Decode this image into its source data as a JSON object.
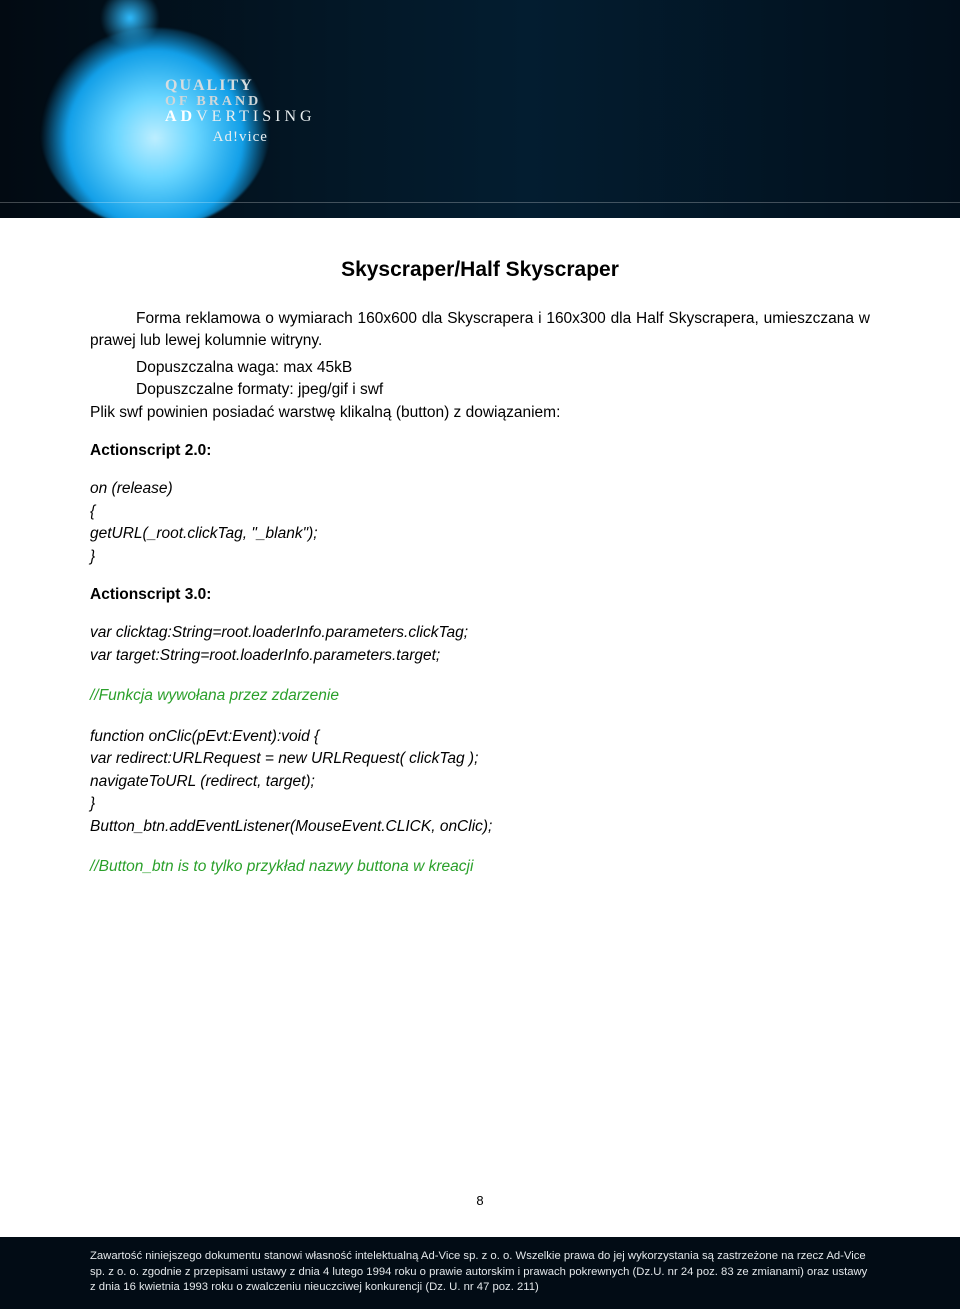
{
  "banner": {
    "line1": "QUALITY",
    "line2": "OF BRAND",
    "line3_bold": "AD",
    "line3_rest": "VERTISING",
    "line4": "Ad!vice"
  },
  "title": "Skyscraper/Half Skyscraper",
  "intro": "Forma reklamowa o wymiarach 160x600 dla Skyscrapera i 160x300 dla Half Skyscrapera, umieszczana w prawej lub lewej kolumnie witryny.",
  "specs": {
    "weight": "Dopuszczalna waga: max 45kB",
    "formats": "Dopuszczalne formaty: jpeg/gif i swf",
    "swfnote": "Plik swf powinien posiadać warstwę klikalną (button) z dowiązaniem:"
  },
  "as2": {
    "heading": "Actionscript 2.0:",
    "code": "on (release)\n{\ngetURL(_root.clickTag, \"_blank\");\n}"
  },
  "as3": {
    "heading": "Actionscript 3.0:",
    "code1": "var clicktag:String=root.loaderInfo.parameters.clickTag;\nvar target:String=root.loaderInfo.parameters.target;",
    "comment1": "//Funkcja wywołana przez zdarzenie",
    "code2": "function onClic(pEvt:Event):void {\nvar redirect:URLRequest = new URLRequest( clickTag );\nnavigateToURL (redirect, target);\n}\nButton_btn.addEventListener(MouseEvent.CLICK, onClic);",
    "comment2": "//Button_btn is to tylko przykład nazwy buttona w kreacji"
  },
  "pagenum": "8",
  "footer": "Zawartość niniejszego dokumentu stanowi własność intelektualną Ad-Vice sp. z o. o. Wszelkie prawa do jej wykorzystania są zastrzeżone na rzecz Ad-Vice sp. z o. o. zgodnie z przepisami ustawy z dnia 4 lutego 1994 roku o prawie autorskim i prawach pokrewnych (Dz.U. nr 24 poz. 83 ze zmianami)  oraz ustawy z dnia 16 kwietnia 1993 roku o zwalczeniu nieuczciwej konkurencji (Dz. U. nr 47 poz. 211)"
}
